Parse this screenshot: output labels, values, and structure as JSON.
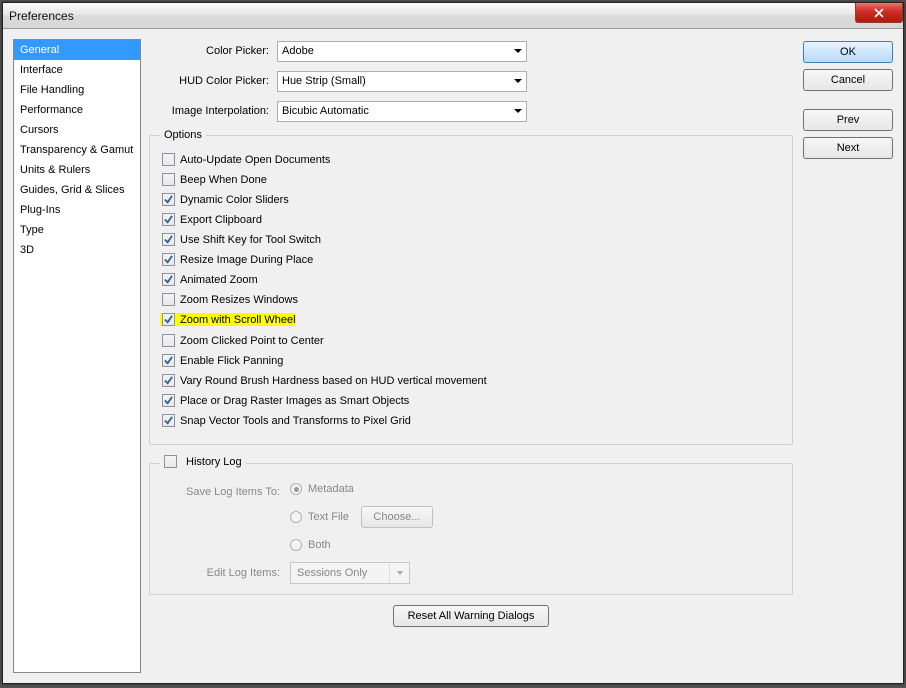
{
  "window": {
    "title": "Preferences"
  },
  "sidebar": {
    "items": [
      {
        "label": "General",
        "selected": true
      },
      {
        "label": "Interface"
      },
      {
        "label": "File Handling"
      },
      {
        "label": "Performance"
      },
      {
        "label": "Cursors"
      },
      {
        "label": "Transparency & Gamut"
      },
      {
        "label": "Units & Rulers"
      },
      {
        "label": "Guides, Grid & Slices"
      },
      {
        "label": "Plug-Ins"
      },
      {
        "label": "Type"
      },
      {
        "label": "3D"
      }
    ]
  },
  "buttons": {
    "ok": "OK",
    "cancel": "Cancel",
    "prev": "Prev",
    "next": "Next"
  },
  "form": {
    "color_picker_label": "Color Picker:",
    "color_picker_value": "Adobe",
    "hud_color_picker_label": "HUD Color Picker:",
    "hud_color_picker_value": "Hue Strip (Small)",
    "image_interp_label": "Image Interpolation:",
    "image_interp_value": "Bicubic Automatic"
  },
  "options": {
    "legend": "Options",
    "items": [
      {
        "label": "Auto-Update Open Documents",
        "checked": false
      },
      {
        "label": "Beep When Done",
        "checked": false
      },
      {
        "label": "Dynamic Color Sliders",
        "checked": true
      },
      {
        "label": "Export Clipboard",
        "checked": true
      },
      {
        "label": "Use Shift Key for Tool Switch",
        "checked": true
      },
      {
        "label": "Resize Image During Place",
        "checked": true
      },
      {
        "label": "Animated Zoom",
        "checked": true
      },
      {
        "label": "Zoom Resizes Windows",
        "checked": false
      },
      {
        "label": "Zoom with Scroll Wheel",
        "checked": true,
        "highlight": true
      },
      {
        "label": "Zoom Clicked Point to Center",
        "checked": false
      },
      {
        "label": "Enable Flick Panning",
        "checked": true
      },
      {
        "label": "Vary Round Brush Hardness based on HUD vertical movement",
        "checked": true
      },
      {
        "label": "Place or Drag Raster Images as Smart Objects",
        "checked": true
      },
      {
        "label": "Snap Vector Tools and Transforms to Pixel Grid",
        "checked": true
      }
    ]
  },
  "history": {
    "legend": "History Log",
    "checked": false,
    "save_label": "Save Log Items To:",
    "radios": {
      "metadata": "Metadata",
      "textfile": "Text File",
      "both": "Both"
    },
    "choose": "Choose...",
    "edit_label": "Edit Log Items:",
    "edit_value": "Sessions Only"
  },
  "reset": {
    "label": "Reset All Warning Dialogs"
  }
}
